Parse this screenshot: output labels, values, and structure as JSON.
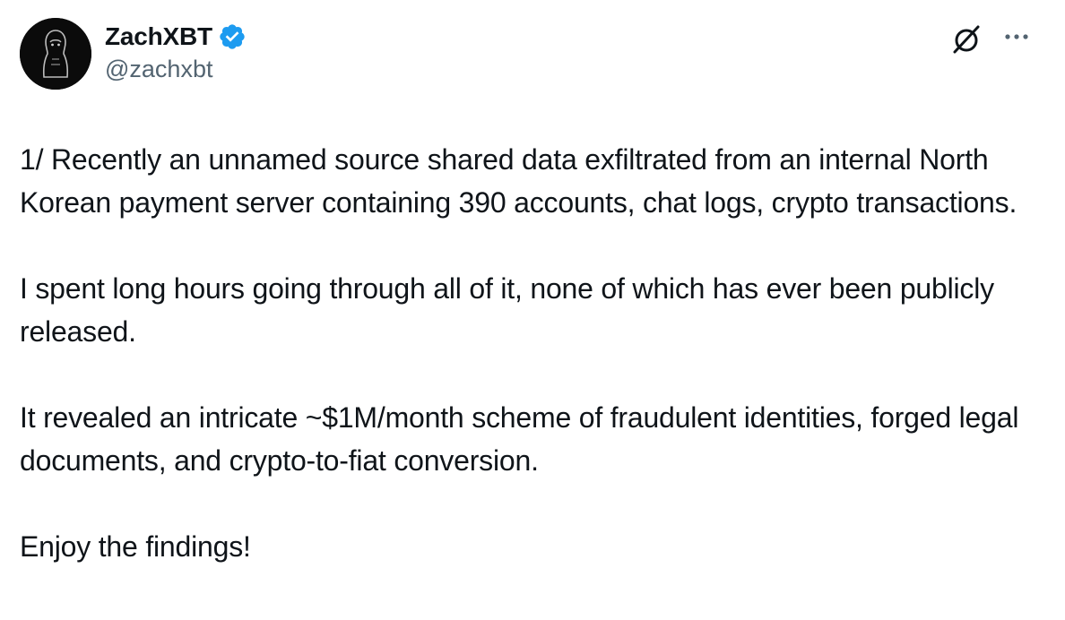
{
  "author": {
    "display_name": "ZachXBT",
    "handle": "@zachxbt",
    "verified": true,
    "verified_color": "#1d9bf0",
    "avatar_icon": "avatar-image"
  },
  "toolbar": {
    "grok_icon": "grok-icon",
    "more_icon": "more-icon"
  },
  "tweet": {
    "paragraphs": [
      "1/ Recently an unnamed source shared data exfiltrated from an internal North Korean payment server containing 390 accounts, chat logs, crypto transactions.",
      "I spent long hours going through all of it, none of which has ever been publicly released.",
      "It revealed an intricate ~$1M/month scheme of fraudulent identities, forged legal documents, and crypto-to-fiat conversion.",
      "Enjoy the findings!"
    ]
  }
}
